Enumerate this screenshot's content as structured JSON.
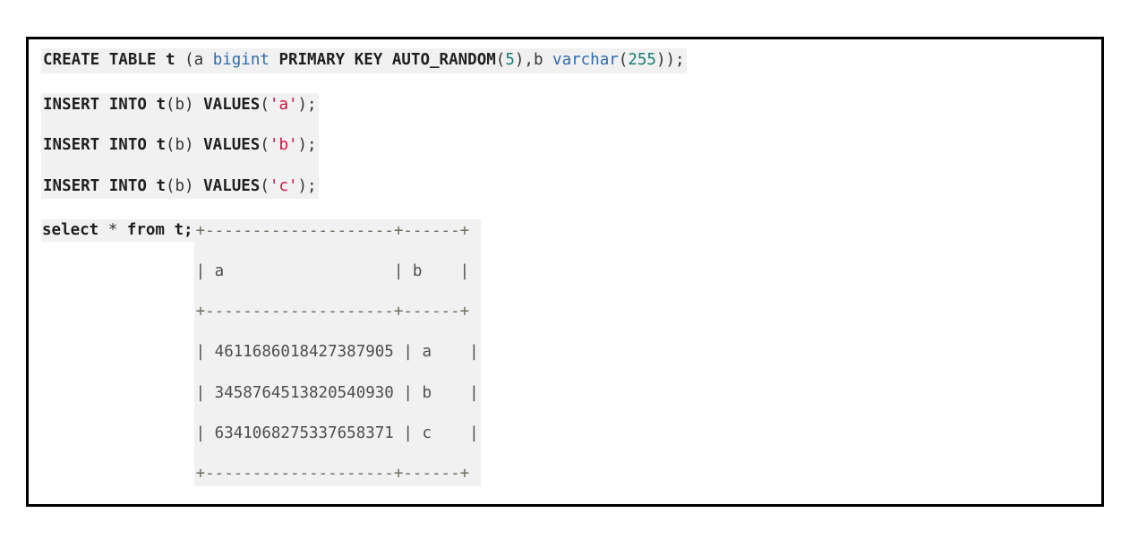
{
  "meta": {
    "language": "sql",
    "theme": "light",
    "code_bg": "#f1f1f1",
    "page_bg": "#ffffff",
    "border_color": "#000000"
  },
  "colors": {
    "keyword": "#1f1f1f",
    "identifier": "#333333",
    "datatype": "#2b6cb0",
    "number": "#197d73",
    "string": "#d01043",
    "punctuation": "#333333",
    "table_rule": "#6b6f5e"
  },
  "blocks": {
    "create": {
      "tokens": {
        "create_table": "CREATE TABLE",
        "table_name": "t",
        "open_paren": " (",
        "col_a": "a ",
        "type_bigint": "bigint",
        "primary_key_auto_random": " PRIMARY KEY AUTO_RANDOM",
        "shard_bits_open": "(",
        "shard_bits": "5",
        "shard_bits_close": "),",
        "col_b": "b ",
        "type_varchar": "varchar",
        "varchar_open": "(",
        "varchar_len": "255",
        "varchar_close": "));"
      }
    },
    "inserts": {
      "lines": [
        {
          "insert_into": "INSERT INTO",
          "table_name": " t",
          "columns": "(b)",
          "values_kw": " VALUES",
          "open": "(",
          "value": "'a'",
          "close": ");"
        },
        {
          "insert_into": "INSERT INTO",
          "table_name": " t",
          "columns": "(b)",
          "values_kw": " VALUES",
          "open": "(",
          "value": "'b'",
          "close": ");"
        },
        {
          "insert_into": "INSERT INTO",
          "table_name": " t",
          "columns": "(b)",
          "values_kw": " VALUES",
          "open": "(",
          "value": "'c'",
          "close": ");"
        }
      ]
    },
    "select": {
      "statement": {
        "select_kw": "select",
        "star": " * ",
        "from_kw": "from t;"
      },
      "result_table": {
        "top_rule": "+--------------------+------+",
        "header_row": "| a                  | b    |",
        "mid_rule": "+--------------------+------+",
        "rows": [
          "| 4611686018427387905 | a    |",
          "| 3458764513820540930 | b    |",
          "| 6341068275337658371 | c    |"
        ],
        "bottom_rule": "+--------------------+------+"
      }
    }
  },
  "result_data": {
    "type": "table",
    "columns": [
      "a",
      "b"
    ],
    "rows": [
      [
        "4611686018427387905",
        "a"
      ],
      [
        "3458764513820540930",
        "b"
      ],
      [
        "6341068275337658371",
        "c"
      ]
    ],
    "row_count": 3
  }
}
